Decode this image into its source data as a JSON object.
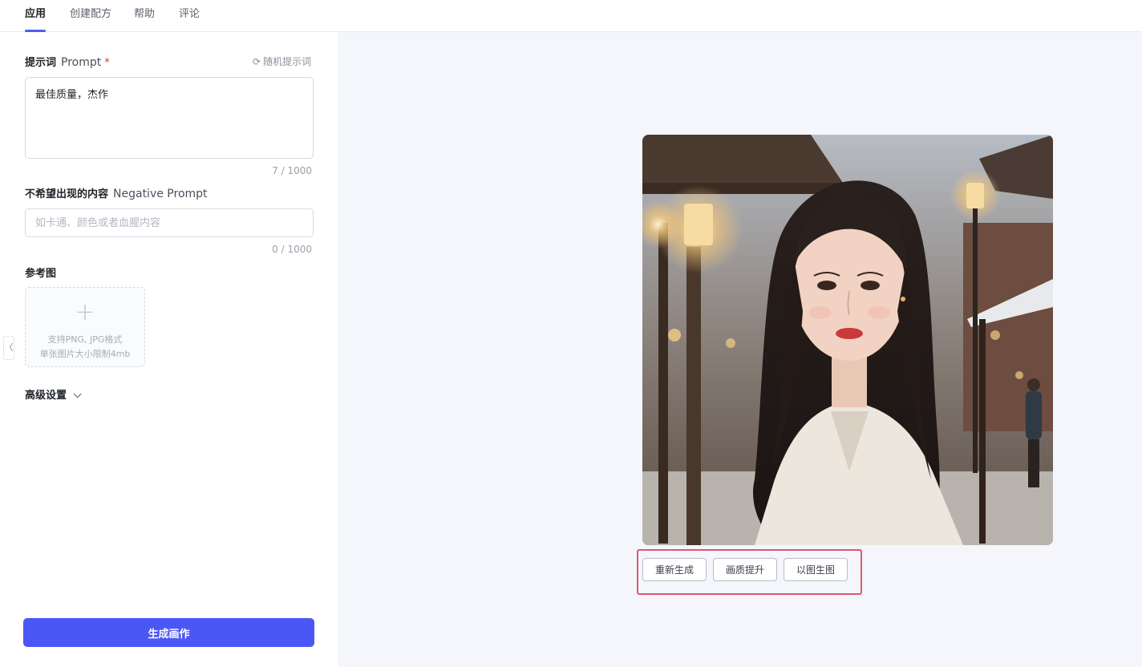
{
  "tabs": [
    {
      "label": "应用",
      "active": true
    },
    {
      "label": "创建配方",
      "active": false
    },
    {
      "label": "帮助",
      "active": false
    },
    {
      "label": "评论",
      "active": false
    }
  ],
  "prompt": {
    "title": "提示词",
    "title_en": "Prompt",
    "required_mark": "*",
    "random_label": "随机提示词",
    "random_icon": "refresh-icon",
    "value": "最佳质量，杰作",
    "counter": "7 / 1000"
  },
  "negative_prompt": {
    "title": "不希望出现的内容",
    "title_en": "Negative Prompt",
    "placeholder": "如卡通、颜色或者血腥内容",
    "value": "",
    "counter": "0 / 1000"
  },
  "reference": {
    "title": "参考图",
    "plus_icon": "plus-icon",
    "hint_line1": "支持PNG, JPG格式",
    "hint_line2": "单张图片大小限制4mb"
  },
  "advanced": {
    "label": "高级设置",
    "icon": "chevron-down-icon"
  },
  "generate_button": "生成画作",
  "collapse_handle": "〈",
  "result_actions": [
    {
      "label": "重新生成"
    },
    {
      "label": "画质提升"
    },
    {
      "label": "以图生图"
    }
  ],
  "colors": {
    "accent": "#4b57f5",
    "highlight_border": "#e05673",
    "canvas_bg": "#f4f6fc"
  }
}
